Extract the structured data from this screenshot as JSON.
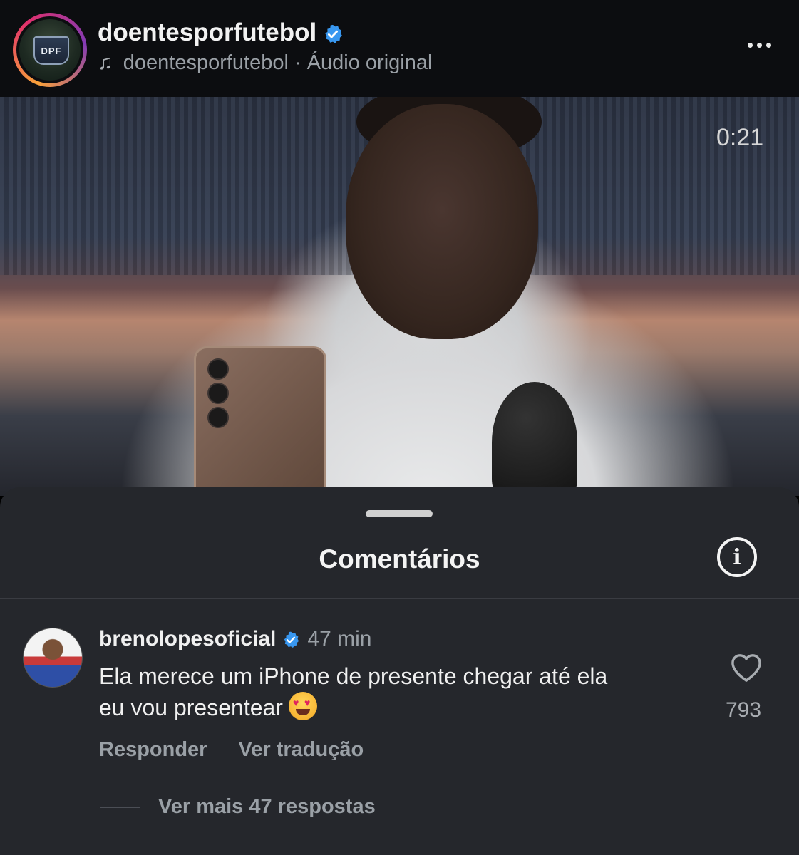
{
  "header": {
    "username": "doentesporfutebol",
    "logo_text": "DPF",
    "audio_label": "doentesporfutebol · Áudio original",
    "icons": {
      "verified": "verified-badge-icon",
      "music": "music-note-icon",
      "more": "more-options-icon"
    }
  },
  "video": {
    "timecode": "0:21"
  },
  "comments": {
    "title": "Comentários",
    "items": [
      {
        "username": "brenolopesoficial",
        "time": "47 min",
        "text_line1": "Ela merece um iPhone de presente chegar até ela",
        "text_line2": "eu vou presentear",
        "likes": "793",
        "reply_label": "Responder",
        "translate_label": "Ver tradução",
        "more_replies_label": "Ver mais 47 respostas"
      }
    ]
  },
  "colors": {
    "verified_blue": "#3897f0",
    "sheet_bg": "#25272c",
    "header_bg": "#0c0d10",
    "muted_text": "#9aa0a6"
  }
}
